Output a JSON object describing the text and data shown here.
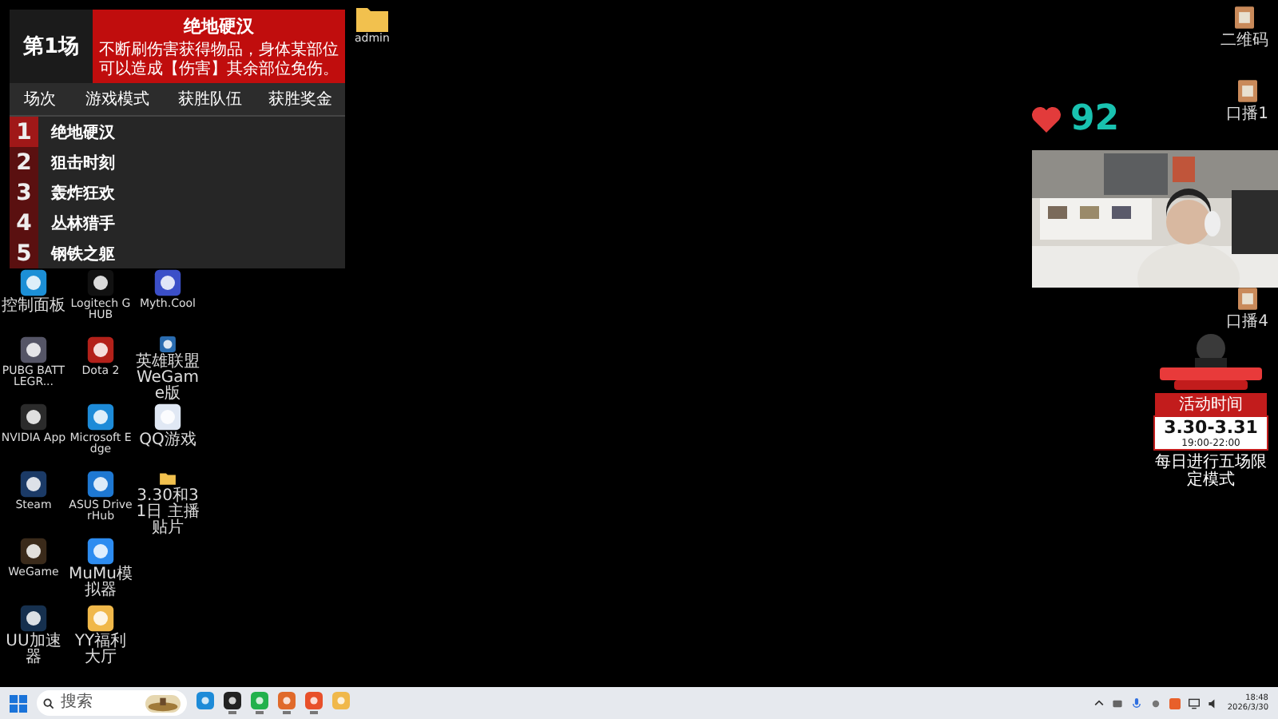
{
  "overlay_panel": {
    "round": "第1场",
    "mode_title": "绝地硬汉",
    "mode_description": "不断刷伤害获得物品，身体某部位可以造成【伤害】其余部位免伤。",
    "columns": [
      "场次",
      "游戏模式",
      "获胜队伍",
      "获胜奖金"
    ],
    "rows": [
      {
        "number": "1",
        "mode": "绝地硬汉",
        "selected": true
      },
      {
        "number": "2",
        "mode": "狙击时刻",
        "selected": false
      },
      {
        "number": "3",
        "mode": "轰炸狂欢",
        "selected": false
      },
      {
        "number": "4",
        "mode": "丛林猎手",
        "selected": false
      },
      {
        "number": "5",
        "mode": "钢铁之躯",
        "selected": false
      }
    ]
  },
  "desktop_icons": [
    {
      "label": "控制面板",
      "kind": "panel"
    },
    {
      "label": "Logitech G HUB",
      "kind": "logi"
    },
    {
      "label": "Myth.Cool",
      "kind": "myth"
    },
    {
      "label": "PUBG BATTLEGR...",
      "kind": "helmet"
    },
    {
      "label": "Dota 2",
      "kind": "dota"
    },
    {
      "label": "英雄联盟 WeGame版",
      "kind": "lol"
    },
    {
      "label": "NVIDIA App",
      "kind": "nvidia"
    },
    {
      "label": "Microsoft Edge",
      "kind": "edge"
    },
    {
      "label": "QQ游戏",
      "kind": "ship"
    },
    {
      "label": "Steam",
      "kind": "steam"
    },
    {
      "label": "ASUS DriverHub",
      "kind": "gear"
    },
    {
      "label": "3.30和31日 主播贴片",
      "kind": "folder"
    },
    {
      "label": "WeGame",
      "kind": "wegame"
    },
    {
      "label": "MuMu模拟器",
      "kind": "mumu"
    },
    {
      "kind": "none"
    },
    {
      "label": "UU加速器",
      "kind": "uu"
    },
    {
      "label": "YY福利大厅",
      "kind": "yy"
    }
  ],
  "top_folder": {
    "label": "admin"
  },
  "right_icons": [
    {
      "label": "二维码"
    },
    {
      "label": "口播1"
    },
    {
      "label": "口播4"
    }
  ],
  "likes": {
    "count": "92"
  },
  "promo": {
    "badge": "活动时间",
    "dates": "3.30-3.31",
    "hours": "19:00-22:00",
    "note": "每日进行五场限定模式"
  },
  "taskbar": {
    "search_placeholder": "搜索",
    "apps": [
      {
        "kind": "edge",
        "running": false
      },
      {
        "kind": "camera",
        "running": true
      },
      {
        "kind": "chat",
        "running": true
      },
      {
        "kind": "orange",
        "running": true
      },
      {
        "kind": "orange2",
        "running": true
      },
      {
        "kind": "yy",
        "running": false
      }
    ],
    "time": "18:48",
    "date": "2026/3/30"
  }
}
